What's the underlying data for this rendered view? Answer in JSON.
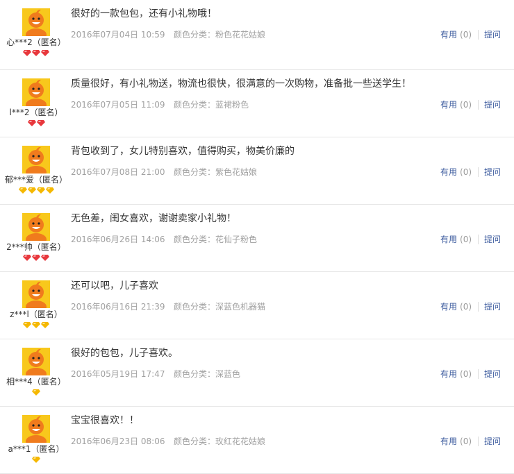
{
  "reviews": [
    {
      "nickname": "心***2（匿名）",
      "content": "很好的一款包包，还有小礼物哦！",
      "date": "2016年07月04日 10:59",
      "sku": "颜色分类：粉色花花姑娘",
      "useful_label": "有用",
      "useful_count": "(0)",
      "ask_label": "提问",
      "badge": "red-diamond",
      "badge_count": 3
    },
    {
      "nickname": "l***2（匿名）",
      "content": "质量很好，有小礼物送，物流也很快，很满意的一次购物，准备批一些送学生！",
      "date": "2016年07月05日 11:09",
      "sku": "颜色分类：蓝裙粉色",
      "useful_label": "有用",
      "useful_count": "(0)",
      "ask_label": "提问",
      "badge": "red-diamond",
      "badge_count": 2
    },
    {
      "nickname": "郁***爱（匿名）",
      "content": "背包收到了，女儿特别喜欢，值得购买，物美价廉的",
      "date": "2016年07月08日 21:00",
      "sku": "颜色分类：紫色花姑娘",
      "useful_label": "有用",
      "useful_count": "(0)",
      "ask_label": "提问",
      "badge": "gold-diamond",
      "badge_count": 4
    },
    {
      "nickname": "2***帅（匿名）",
      "content": "无色差，闺女喜欢，谢谢卖家小礼物！",
      "date": "2016年06月26日 14:06",
      "sku": "颜色分类：花仙子粉色",
      "useful_label": "有用",
      "useful_count": "(0)",
      "ask_label": "提问",
      "badge": "red-diamond",
      "badge_count": 3
    },
    {
      "nickname": "z***l（匿名）",
      "content": "还可以吧，儿子喜欢",
      "date": "2016年06月16日 21:39",
      "sku": "颜色分类：深蓝色机器猫",
      "useful_label": "有用",
      "useful_count": "(0)",
      "ask_label": "提问",
      "badge": "gold-diamond",
      "badge_count": 3
    },
    {
      "nickname": "相***4（匿名）",
      "content": "很好的包包，儿子喜欢。",
      "date": "2016年05月19日 17:47",
      "sku": "颜色分类：深蓝色",
      "useful_label": "有用",
      "useful_count": "(0)",
      "ask_label": "提问",
      "badge": "gold-diamond",
      "badge_count": 1
    },
    {
      "nickname": "a***1（匿名）",
      "content": "宝宝很喜欢！！",
      "date": "2016年06月23日 08:06",
      "sku": "颜色分类：玫红花花姑娘",
      "useful_label": "有用",
      "useful_count": "(0)",
      "ask_label": "提问",
      "badge": "gold-diamond",
      "badge_count": 1
    }
  ],
  "colors": {
    "avatar_bg": "#f8c81c",
    "mascot": "#f07b1d",
    "link": "#3c5b9e",
    "meta": "#a0a0a0",
    "red_gem": "#e8383d",
    "gold_gem": "#f5b800"
  }
}
